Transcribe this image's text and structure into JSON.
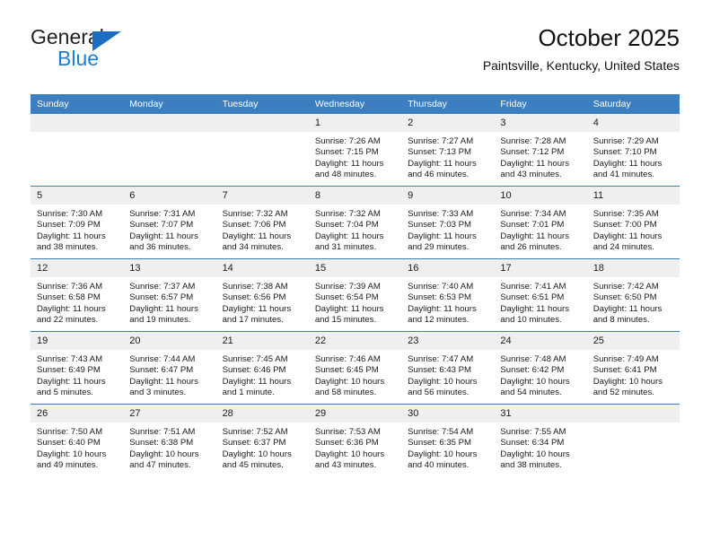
{
  "brand": {
    "name_part1": "General",
    "name_part2": "Blue",
    "triangle_color": "#1b6ec2",
    "blue_color": "#1b7fd4"
  },
  "header": {
    "title": "October 2025",
    "subtitle": "Paintsville, Kentucky, United States",
    "accent_color": "#3c7ebf"
  },
  "calendar": {
    "weekday_headers": [
      "Sunday",
      "Monday",
      "Tuesday",
      "Wednesday",
      "Thursday",
      "Friday",
      "Saturday"
    ],
    "header_bg": "#3c7ebf",
    "daynum_bg": "#efefef",
    "weeks": [
      [
        {
          "day": "",
          "empty": true
        },
        {
          "day": "",
          "empty": true
        },
        {
          "day": "",
          "empty": true
        },
        {
          "day": "1",
          "sunrise": "Sunrise: 7:26 AM",
          "sunset": "Sunset: 7:15 PM",
          "daylight": "Daylight: 11 hours and 48 minutes."
        },
        {
          "day": "2",
          "sunrise": "Sunrise: 7:27 AM",
          "sunset": "Sunset: 7:13 PM",
          "daylight": "Daylight: 11 hours and 46 minutes."
        },
        {
          "day": "3",
          "sunrise": "Sunrise: 7:28 AM",
          "sunset": "Sunset: 7:12 PM",
          "daylight": "Daylight: 11 hours and 43 minutes."
        },
        {
          "day": "4",
          "sunrise": "Sunrise: 7:29 AM",
          "sunset": "Sunset: 7:10 PM",
          "daylight": "Daylight: 11 hours and 41 minutes."
        }
      ],
      [
        {
          "day": "5",
          "sunrise": "Sunrise: 7:30 AM",
          "sunset": "Sunset: 7:09 PM",
          "daylight": "Daylight: 11 hours and 38 minutes."
        },
        {
          "day": "6",
          "sunrise": "Sunrise: 7:31 AM",
          "sunset": "Sunset: 7:07 PM",
          "daylight": "Daylight: 11 hours and 36 minutes."
        },
        {
          "day": "7",
          "sunrise": "Sunrise: 7:32 AM",
          "sunset": "Sunset: 7:06 PM",
          "daylight": "Daylight: 11 hours and 34 minutes."
        },
        {
          "day": "8",
          "sunrise": "Sunrise: 7:32 AM",
          "sunset": "Sunset: 7:04 PM",
          "daylight": "Daylight: 11 hours and 31 minutes."
        },
        {
          "day": "9",
          "sunrise": "Sunrise: 7:33 AM",
          "sunset": "Sunset: 7:03 PM",
          "daylight": "Daylight: 11 hours and 29 minutes."
        },
        {
          "day": "10",
          "sunrise": "Sunrise: 7:34 AM",
          "sunset": "Sunset: 7:01 PM",
          "daylight": "Daylight: 11 hours and 26 minutes."
        },
        {
          "day": "11",
          "sunrise": "Sunrise: 7:35 AM",
          "sunset": "Sunset: 7:00 PM",
          "daylight": "Daylight: 11 hours and 24 minutes."
        }
      ],
      [
        {
          "day": "12",
          "sunrise": "Sunrise: 7:36 AM",
          "sunset": "Sunset: 6:58 PM",
          "daylight": "Daylight: 11 hours and 22 minutes."
        },
        {
          "day": "13",
          "sunrise": "Sunrise: 7:37 AM",
          "sunset": "Sunset: 6:57 PM",
          "daylight": "Daylight: 11 hours and 19 minutes."
        },
        {
          "day": "14",
          "sunrise": "Sunrise: 7:38 AM",
          "sunset": "Sunset: 6:56 PM",
          "daylight": "Daylight: 11 hours and 17 minutes."
        },
        {
          "day": "15",
          "sunrise": "Sunrise: 7:39 AM",
          "sunset": "Sunset: 6:54 PM",
          "daylight": "Daylight: 11 hours and 15 minutes."
        },
        {
          "day": "16",
          "sunrise": "Sunrise: 7:40 AM",
          "sunset": "Sunset: 6:53 PM",
          "daylight": "Daylight: 11 hours and 12 minutes."
        },
        {
          "day": "17",
          "sunrise": "Sunrise: 7:41 AM",
          "sunset": "Sunset: 6:51 PM",
          "daylight": "Daylight: 11 hours and 10 minutes."
        },
        {
          "day": "18",
          "sunrise": "Sunrise: 7:42 AM",
          "sunset": "Sunset: 6:50 PM",
          "daylight": "Daylight: 11 hours and 8 minutes."
        }
      ],
      [
        {
          "day": "19",
          "sunrise": "Sunrise: 7:43 AM",
          "sunset": "Sunset: 6:49 PM",
          "daylight": "Daylight: 11 hours and 5 minutes."
        },
        {
          "day": "20",
          "sunrise": "Sunrise: 7:44 AM",
          "sunset": "Sunset: 6:47 PM",
          "daylight": "Daylight: 11 hours and 3 minutes."
        },
        {
          "day": "21",
          "sunrise": "Sunrise: 7:45 AM",
          "sunset": "Sunset: 6:46 PM",
          "daylight": "Daylight: 11 hours and 1 minute."
        },
        {
          "day": "22",
          "sunrise": "Sunrise: 7:46 AM",
          "sunset": "Sunset: 6:45 PM",
          "daylight": "Daylight: 10 hours and 58 minutes."
        },
        {
          "day": "23",
          "sunrise": "Sunrise: 7:47 AM",
          "sunset": "Sunset: 6:43 PM",
          "daylight": "Daylight: 10 hours and 56 minutes."
        },
        {
          "day": "24",
          "sunrise": "Sunrise: 7:48 AM",
          "sunset": "Sunset: 6:42 PM",
          "daylight": "Daylight: 10 hours and 54 minutes."
        },
        {
          "day": "25",
          "sunrise": "Sunrise: 7:49 AM",
          "sunset": "Sunset: 6:41 PM",
          "daylight": "Daylight: 10 hours and 52 minutes."
        }
      ],
      [
        {
          "day": "26",
          "sunrise": "Sunrise: 7:50 AM",
          "sunset": "Sunset: 6:40 PM",
          "daylight": "Daylight: 10 hours and 49 minutes."
        },
        {
          "day": "27",
          "sunrise": "Sunrise: 7:51 AM",
          "sunset": "Sunset: 6:38 PM",
          "daylight": "Daylight: 10 hours and 47 minutes."
        },
        {
          "day": "28",
          "sunrise": "Sunrise: 7:52 AM",
          "sunset": "Sunset: 6:37 PM",
          "daylight": "Daylight: 10 hours and 45 minutes."
        },
        {
          "day": "29",
          "sunrise": "Sunrise: 7:53 AM",
          "sunset": "Sunset: 6:36 PM",
          "daylight": "Daylight: 10 hours and 43 minutes."
        },
        {
          "day": "30",
          "sunrise": "Sunrise: 7:54 AM",
          "sunset": "Sunset: 6:35 PM",
          "daylight": "Daylight: 10 hours and 40 minutes."
        },
        {
          "day": "31",
          "sunrise": "Sunrise: 7:55 AM",
          "sunset": "Sunset: 6:34 PM",
          "daylight": "Daylight: 10 hours and 38 minutes."
        },
        {
          "day": "",
          "empty": true
        }
      ]
    ]
  }
}
